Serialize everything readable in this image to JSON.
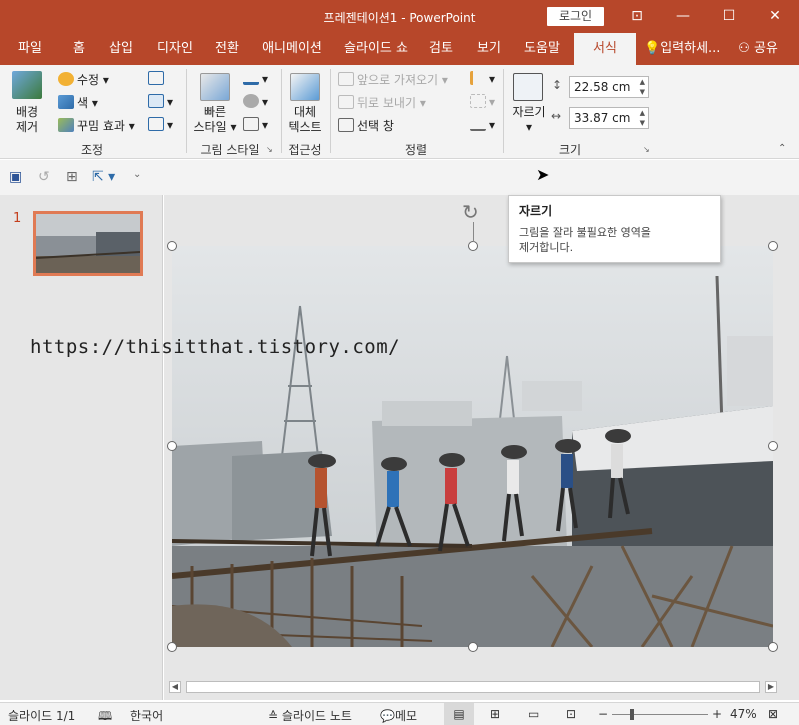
{
  "window": {
    "title": "프레젠테이션1  -  PowerPoint",
    "login_label": "로그인",
    "controls": {
      "restore_ribbon": "⊡",
      "minimize": "—",
      "maximize": "☐",
      "close": "✕"
    }
  },
  "tabs": [
    {
      "label": "파일"
    },
    {
      "label": "홈"
    },
    {
      "label": "삽입"
    },
    {
      "label": "디자인"
    },
    {
      "label": "전환"
    },
    {
      "label": "애니메이션"
    },
    {
      "label": "슬라이드 쇼"
    },
    {
      "label": "검토"
    },
    {
      "label": "보기"
    },
    {
      "label": "도움말"
    },
    {
      "label": "서식",
      "active": true
    }
  ],
  "tell_me": "입력하세...",
  "share": "공유",
  "ribbon": {
    "adjust": {
      "remove_bg_line1": "배경",
      "remove_bg_line2": "제거",
      "corrections": "수정",
      "color": "색",
      "artistic": "꾸밈 효과",
      "label": "조정"
    },
    "styles": {
      "quick_styles_line1": "빠른",
      "quick_styles_line2": "스타일",
      "label": "그림 스타일"
    },
    "accessibility": {
      "alt_text_line1": "대체",
      "alt_text_line2": "텍스트",
      "label": "접근성"
    },
    "arrange": {
      "bring_forward": "앞으로 가져오기",
      "send_backward": "뒤로 보내기",
      "selection_pane": "선택 창",
      "label": "정렬"
    },
    "size": {
      "crop": "자르기",
      "height": "22.58 cm",
      "width": "33.87 cm",
      "label": "크기"
    }
  },
  "thumbnails": {
    "slide_number": "1"
  },
  "tooltip": {
    "title": "자르기",
    "body_line1": "그림을 잘라 불필요한 영역을",
    "body_line2": "제거합니다."
  },
  "watermark": "https://thisitthat.tistory.com/",
  "status": {
    "slide_indicator": "슬라이드 1/1",
    "language": "한국어",
    "notes": "슬라이드 노트",
    "comments": "메모",
    "zoom": "47%",
    "zoom_level": 0.47
  },
  "colors": {
    "brand": "#b7472a",
    "active_tab_text": "#b7472a",
    "thumbnail_border": "#e07a54"
  }
}
